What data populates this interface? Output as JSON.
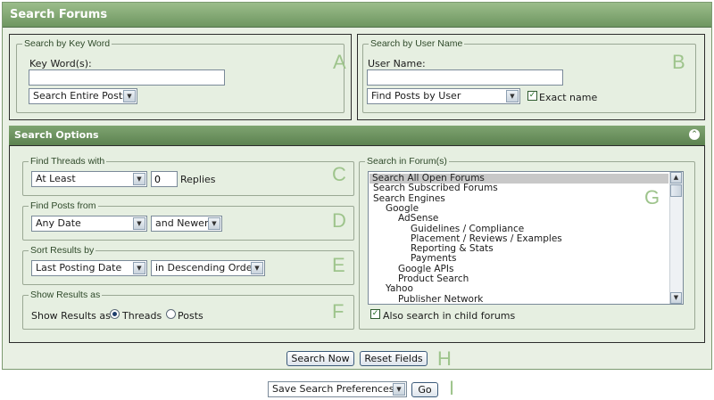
{
  "title": "Search Forums",
  "keyword": {
    "legend": "Search by Key Word",
    "label": "Key Word(s):",
    "value": "",
    "scope": "Search Entire Posts",
    "marker": "A"
  },
  "username": {
    "legend": "Search by User Name",
    "label": "User Name:",
    "value": "",
    "mode": "Find Posts by User",
    "exact_label": "Exact name",
    "exact_checked": true,
    "marker": "B"
  },
  "options": {
    "header": "Search Options",
    "find_threads": {
      "legend": "Find Threads with",
      "qualifier": "At Least",
      "count": "0",
      "unit": "Replies",
      "marker": "C"
    },
    "find_posts": {
      "legend": "Find Posts from",
      "date": "Any Date",
      "direction": "and Newer",
      "marker": "D"
    },
    "sort": {
      "legend": "Sort Results by",
      "field": "Last Posting Date",
      "order": "in Descending Order",
      "marker": "E"
    },
    "show": {
      "legend": "Show Results as",
      "label": "Show Results as",
      "threads": "Threads",
      "posts": "Posts",
      "selected": "threads",
      "marker": "F"
    },
    "forums": {
      "legend": "Search in Forum(s)",
      "items": [
        {
          "label": "Search All Open Forums",
          "level": 0,
          "selected": true
        },
        {
          "label": "Search Subscribed Forums",
          "level": 0
        },
        {
          "label": "Search Engines",
          "level": 0
        },
        {
          "label": "Google",
          "level": 1
        },
        {
          "label": "AdSense",
          "level": 2
        },
        {
          "label": "Guidelines / Compliance",
          "level": 3
        },
        {
          "label": "Placement / Reviews / Examples",
          "level": 3
        },
        {
          "label": "Reporting & Stats",
          "level": 3
        },
        {
          "label": "Payments",
          "level": 3
        },
        {
          "label": "Google APIs",
          "level": 2
        },
        {
          "label": "Product Search",
          "level": 2
        },
        {
          "label": "Yahoo",
          "level": 1
        },
        {
          "label": "Publisher Network",
          "level": 2
        }
      ],
      "child_label": "Also search in child forums",
      "child_checked": true,
      "marker": "G"
    }
  },
  "actions": {
    "search": "Search Now",
    "reset": "Reset Fields",
    "marker": "H"
  },
  "prefs": {
    "select": "Save Search Preferences",
    "go": "Go",
    "marker": "I"
  },
  "icons": {
    "collapse": "collapse-icon",
    "dropdown": "chevron-down-icon",
    "check": "checkmark-icon"
  },
  "colors": {
    "header": "#7fa471",
    "panel": "#e6efe1",
    "letters": "#9ec48c"
  }
}
